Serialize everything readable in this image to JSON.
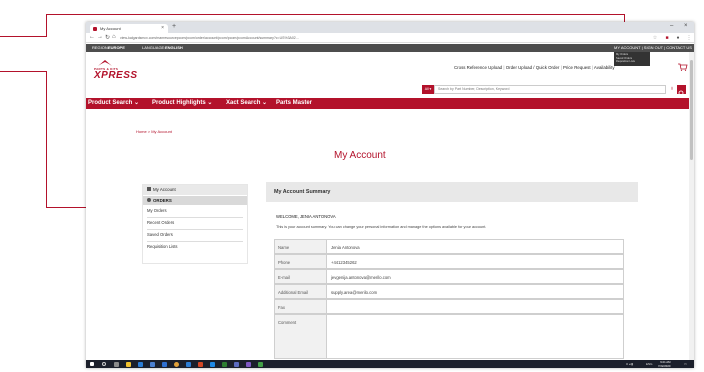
{
  "browser": {
    "tab_title": "My Account",
    "tab_close": "×",
    "new_tab": "+",
    "url": "view-kalgardsmcx.com/manresourcepcom/pcom/order/account/pcom/pcom/pcomAccount/summary?c=US%3A02...",
    "window_minimize": "–",
    "window_close": "×"
  },
  "topbar": {
    "region_label": "REGION:",
    "region_value": "EUROPE",
    "language_label": "LANGUAGE:",
    "language_value": "ENGLISH",
    "right_links": "MY ACCOUNT | SIGN OUT | CONTACT US",
    "account_menu": [
      "My Orders",
      "Saved Orders",
      "Requisition Lists"
    ]
  },
  "logo": {
    "tagline": "PARTS & KITS",
    "name": "XPRESS"
  },
  "header_links": {
    "items": [
      "Cross Reference Upload",
      "Order Upload / Quick Order",
      "Price Request",
      "Availability"
    ]
  },
  "search": {
    "dropdown_label": "All",
    "placeholder": "Search by Part Number, Description, Keyword"
  },
  "main_nav": {
    "items": [
      "Product Search",
      "Product Highlights",
      "Xact Search",
      "Parts Master"
    ],
    "chevron": "⌄"
  },
  "breadcrumb": "Home  >  My Account",
  "page_title": "My Account",
  "sidebar": {
    "heading": "My Account",
    "orders_label": "ORDERS",
    "items": [
      "My Orders",
      "Recent Orders",
      "Saved Orders",
      "Requisition Lists"
    ]
  },
  "summary": {
    "heading": "My Account Summary",
    "welcome": "WELCOME, JENIA ANTONOVA",
    "description": "This is your account summary. You can change your personal information and manage the options available for your account.",
    "rows": [
      {
        "label": "Name",
        "value": "Jenia Antonova"
      },
      {
        "label": "Phone",
        "value": "+4412345262"
      },
      {
        "label": "E-mail",
        "value": "jevgenija.antonova@merilo.com"
      },
      {
        "label": "Additional Email",
        "value": "supply.area@merilo.com"
      },
      {
        "label": "Fax",
        "value": ""
      },
      {
        "label": "Comment",
        "value": ""
      }
    ]
  },
  "taskbar": {
    "clock_time": "9:21 AM",
    "clock_date": "7/22/2020",
    "tray_lang": "ENG"
  },
  "colors": {
    "brand": "#b3122b",
    "topbar": "#4d4d4d",
    "taskbar": "#1b1f2b"
  }
}
